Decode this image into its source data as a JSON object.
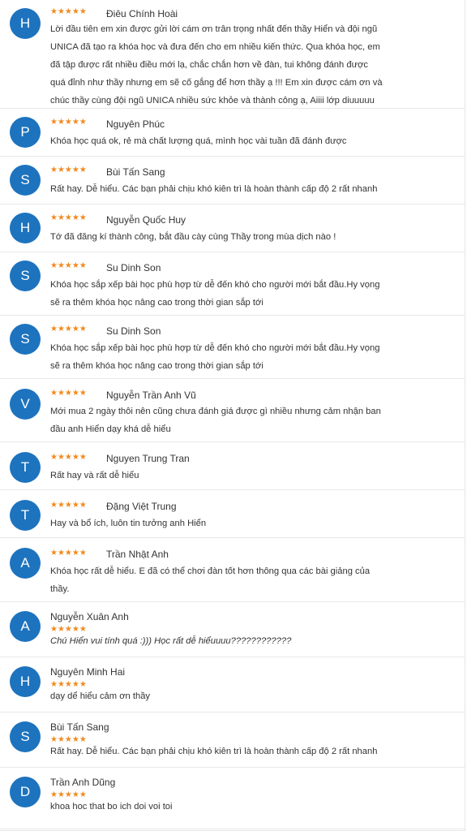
{
  "reviews": [
    {
      "initial": "H",
      "name": "Điêu Chính Hoài",
      "rating": 5,
      "text": "Lời đầu tiên em xin được gửi lời cám ơn trân trọng nhất đến thầy Hiển và đội ngũ UNICA đã tạo ra khóa học và đưa đến cho em nhiều kiến thức. Qua khóa học, em đã tập được rất nhiều điều mới lạ, chắc chắn hơn về đàn, tui không đánh được quá đỉnh như thầy nhưng em sẽ cố gắng để hơn thầy ạ !!! Em xin được cám ơn và chúc thầy cùng đội ngũ UNICA nhiều sức khỏe và thành công ạ, Aiiii lớp diuuuuu"
    },
    {
      "initial": "P",
      "name": "Nguyên Phúc",
      "rating": 5,
      "text": "Khóa học quá ok, rẻ mà chất lượng quá, mình học vài tuần đã đánh được"
    },
    {
      "initial": "S",
      "name": "Bùi Tấn Sang",
      "rating": 5,
      "text": "Rất hay. Dễ hiểu. Các bạn phải chịu khó kiên trì là hoàn thành cấp độ 2 rất nhanh"
    },
    {
      "initial": "H",
      "name": "Nguyễn Quốc Huy",
      "rating": 5,
      "text": "Tớ đã đăng kí thành công, bắt đầu cày cùng Thầy trong mùa dịch nào !"
    },
    {
      "initial": "S",
      "name": "Su Dinh Son",
      "rating": 5,
      "text": "Khóa học sắp xếp bài học phù hợp từ dễ đến khó cho người mới bắt đầu.Hy vọng sẽ ra thêm khóa học nâng cao trong thời gian sắp tới"
    },
    {
      "initial": "S",
      "name": "Su Dinh Son",
      "rating": 5,
      "text": "Khóa học sắp xếp bài học phù hợp từ dễ đến khó cho người mới bắt đầu.Hy vọng sẽ ra thêm khóa học nâng cao trong thời gian sắp tới"
    },
    {
      "initial": "V",
      "name": "Nguyễn Trần Anh Vũ",
      "rating": 5,
      "text": "Mới mua 2 ngày thôi nên cũng chưa đánh giá được gì nhiều nhưng cảm nhận ban đầu anh Hiển dạy khá dễ hiểu"
    },
    {
      "initial": "T",
      "name": "Nguyen Trung Tran",
      "rating": 5,
      "text": "Rất hay và rất dễ hiểu"
    },
    {
      "initial": "T",
      "name": "Đặng Việt Trung",
      "rating": 5,
      "text": "Hay và bổ ích, luôn tin tưởng anh Hiển"
    },
    {
      "initial": "A",
      "name": "Trần Nhật Anh",
      "rating": 5,
      "text": "Khóa học rất dễ hiểu. E đã có thể chơi đàn tốt hơn thông qua các bài giảng của thầy."
    },
    {
      "initial": "A",
      "name": "Nguyễn Xuân Anh",
      "rating": 5,
      "text": "Chú Hiển vui tính quá :))) Học rất dễ hiểuuuu????????????"
    },
    {
      "initial": "H",
      "name": "Nguyên Minh Hai",
      "rating": 5,
      "text": "dạy dể hiểu cảm ơn thầy"
    },
    {
      "initial": "S",
      "name": "Bùi Tấn Sang",
      "rating": 5,
      "text": "Rất hay. Dễ hiểu. Các bạn phải chịu khó kiên trì là hoàn thành cấp độ 2 rất nhanh"
    },
    {
      "initial": "D",
      "name": "Trần Anh Dũng",
      "rating": 5,
      "text": "khoa hoc that bo ich doi voi toi"
    }
  ]
}
